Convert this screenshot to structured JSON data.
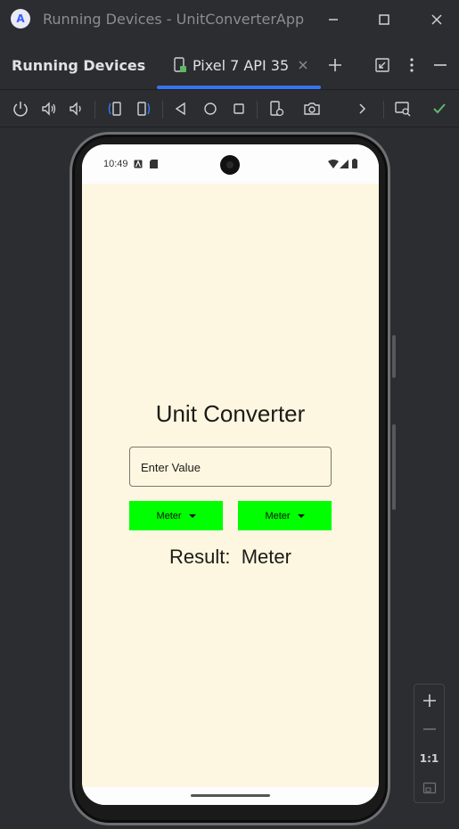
{
  "window": {
    "title": "Running Devices - UnitConverterApp",
    "minimize_glyph": "—",
    "maximize_glyph": "□",
    "close_glyph": "✕"
  },
  "panel": {
    "label": "Running Devices",
    "tab_label": "Pixel 7 API 35",
    "tab_close": "✕",
    "add_glyph": "+",
    "more_glyph": "⋮",
    "hide_glyph": "—"
  },
  "device": {
    "status_time": "10:49",
    "app": {
      "heading": "Unit Converter",
      "input_placeholder": "Enter Value",
      "input_value": "",
      "from_unit": "Meter",
      "to_unit": "Meter",
      "result_label": "Result:",
      "result_value": "Meter"
    }
  },
  "zoom": {
    "plus": "+",
    "minus": "—",
    "one_to_one": "1:1"
  },
  "colors": {
    "accent": "#3574f0",
    "app_background": "#fdf7e2",
    "dropdown_green": "#00ff00",
    "check_green": "#5fb865"
  }
}
